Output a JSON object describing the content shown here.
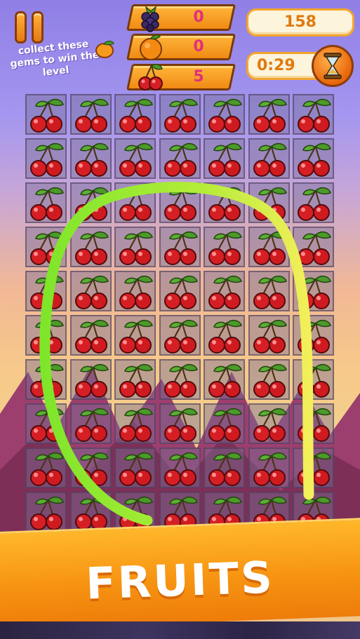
{
  "hud": {
    "pause_icon": "pause-icon",
    "hint_text": "collect these gems to win the level",
    "goals": [
      {
        "fruit": "blackberry",
        "count": "0"
      },
      {
        "fruit": "orange",
        "count": "0"
      },
      {
        "fruit": "cherry",
        "count": "5"
      }
    ],
    "score": "158",
    "timer": "0:29",
    "hourglass_icon": "hourglass-icon"
  },
  "board": {
    "rows": 10,
    "cols": 7,
    "tile": "cherry"
  },
  "banner": {
    "title": "FRUITS"
  },
  "colors": {
    "accent": "#f79412",
    "counter": "#e0307a",
    "score_text": "#e07a10",
    "swipe_start": "#7ee62a",
    "swipe_end": "#f3ef5a"
  }
}
